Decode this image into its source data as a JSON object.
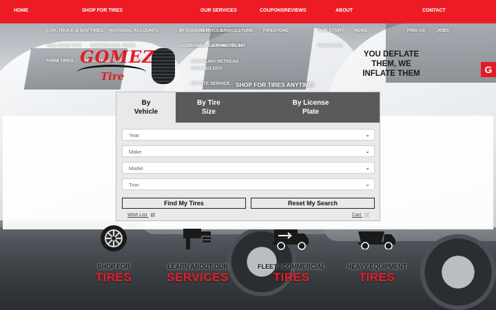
{
  "nav": {
    "home": "HOME",
    "shop_for_tires": "SHOP FOR TIRES",
    "our_services": "OUR SERVICES",
    "coupons_reviews": "COUPONSREVIEWS",
    "about": "ABOUT",
    "contact": "CONTACT"
  },
  "shop_menu": {
    "col1": [
      "CAR, TRUCK & SUV TIRES",
      "TIRE CARE TIPS",
      "FARM TIRES"
    ],
    "col2": [
      "NATIONAL ACCOUNTS",
      "COMMERCIAL TIRES",
      "INDUSTRIAL TIRES"
    ],
    "col3": [
      "OTR TIRES"
    ]
  },
  "services_menu": {
    "col1": [
      "BFGOODRICH",
      "GOODYEAR",
      "MICHELIN® RETREAD TECHNOLOGY",
      "ON-SITE SERVICE"
    ],
    "col2": [
      "SERVICES",
      "SCHEDULE AN",
      "APPOINTMENT"
    ],
    "col3": [
      "BRIDGESTONE",
      "MICHELIN®"
    ],
    "col4": [
      "FIRESTONE"
    ]
  },
  "about_menu": {
    "items": [
      "OUR STORY",
      "NEWS",
      "FINANCING"
    ]
  },
  "contact_menu": {
    "items": [
      "FIND US",
      "JOBS"
    ]
  },
  "logo": {
    "name": "GOMEZ",
    "sub": "Tire"
  },
  "tagline": "YOU DEFLATE THEM, WE INFLATE THEM",
  "badge": "G",
  "shop_anytime": "SHOP FOR TIRES ANYTIME!",
  "search": {
    "tabs": [
      {
        "line1": "By",
        "line2": "Vehicle"
      },
      {
        "line1": "By Tire",
        "line2": "Size"
      },
      {
        "line1": "By License",
        "line2": "Plate"
      }
    ],
    "fields": [
      "Year",
      "Make",
      "Model",
      "Trim"
    ],
    "find_button": "Find My Tires",
    "reset_button": "Reset My Search",
    "wish_list": "Wish List",
    "cart": "Cart"
  },
  "categories": [
    {
      "caption": "SHOP FOR",
      "big": "TIRES",
      "icon": "tire-icon"
    },
    {
      "caption": "LEARN ABOUT OUR",
      "big": "SERVICES",
      "icon": "tire-service-icon"
    },
    {
      "caption": "FLEET / COMMERCIAL",
      "big": "TIRES",
      "icon": "fleet-truck-icon"
    },
    {
      "caption": "HEAVY EQUIPMENT",
      "big": "TIRES",
      "icon": "dump-truck-icon"
    }
  ],
  "colors": {
    "brand_red": "#ed1c24",
    "tab_dark": "#5a5a5a"
  }
}
